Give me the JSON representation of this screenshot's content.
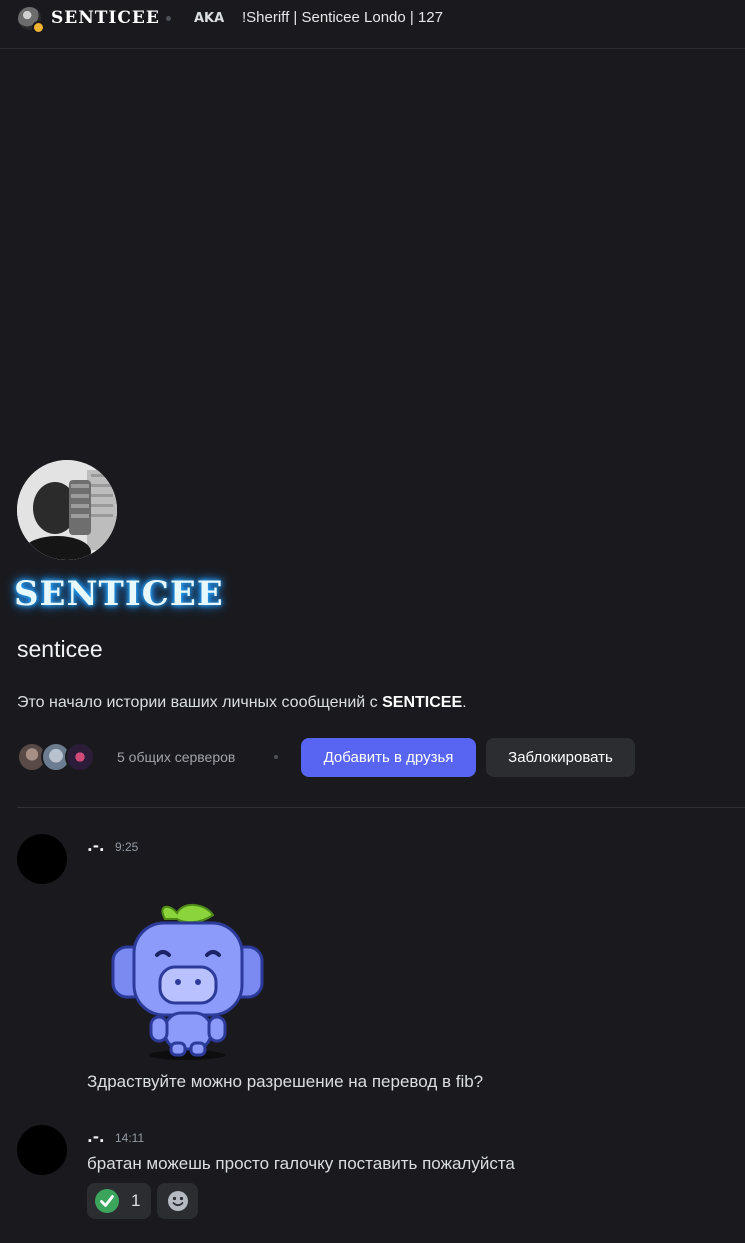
{
  "header": {
    "name": "SENTICEE",
    "aka_label": "AKA",
    "nicknames": "!Sheriff | Senticee Londo | 127"
  },
  "profile": {
    "display_name": "SENTICEE",
    "username": "senticee",
    "intro_prefix": "Это начало истории ваших личных сообщений с ",
    "intro_name": "SENTICEE",
    "intro_suffix": ".",
    "mutual_servers": "5 общих серверов",
    "add_friend_label": "Добавить в друзья",
    "block_label": "Заблокировать",
    "colors": {
      "accent": "#5865f2",
      "glow": "#1e90ff"
    }
  },
  "messages": [
    {
      "author": ".-.",
      "time": "9:25",
      "sticker": "wumpus-sticker",
      "text": "Здраствуйте можно разрешение на перевод в fib?"
    },
    {
      "author": ".-.",
      "time": "14:11",
      "text": "братан можешь просто галочку поставить пожалуйста",
      "reactions": [
        {
          "emoji": "check-mark-icon",
          "count": "1"
        }
      ]
    }
  ]
}
